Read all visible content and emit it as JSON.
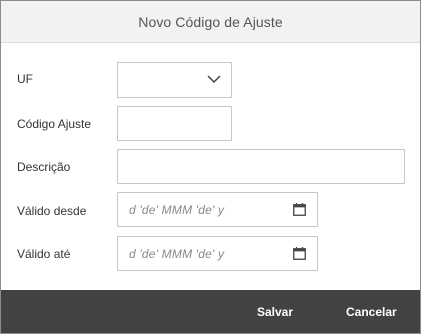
{
  "dialog": {
    "title": "Novo Código de Ajuste"
  },
  "form": {
    "uf": {
      "label": "UF",
      "value": "",
      "icon": "chevron-down-icon"
    },
    "codigo_ajuste": {
      "label": "Código Ajuste",
      "value": ""
    },
    "descricao": {
      "label": "Descrição",
      "value": ""
    },
    "valido_desde": {
      "label": "Válido desde",
      "placeholder": "d 'de' MMM 'de' y",
      "icon": "calendar-icon"
    },
    "valido_ate": {
      "label": "Válido até",
      "placeholder": "d 'de' MMM 'de' y",
      "icon": "calendar-icon"
    }
  },
  "footer": {
    "save_label": "Salvar",
    "cancel_label": "Cancelar",
    "background_color": "#404244"
  }
}
